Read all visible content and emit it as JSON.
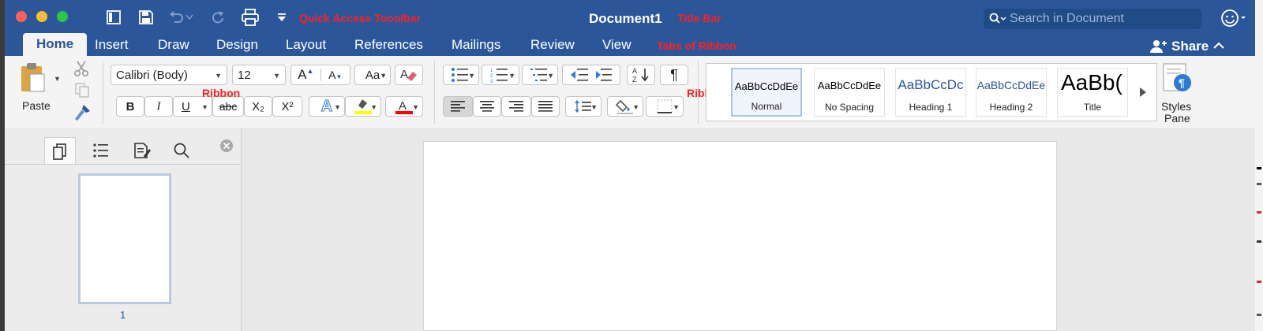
{
  "window": {
    "title": "Document1",
    "accent": "#2b579a",
    "traffic_lights": [
      "#fe5f57",
      "#febc2e",
      "#28c840"
    ]
  },
  "annotations": {
    "quick_access": "Quick Access Tooolbar",
    "title_bar": "Title Bar",
    "tabs": "Tabs of Ribbon",
    "ribbon_left": "Ribbon",
    "ribbon_right": "Ribbon",
    "color": "#ff1f1f"
  },
  "quick_access_toolbar": {
    "icons": [
      "sidebar-icon",
      "save-icon",
      "undo-icon",
      "redo-icon",
      "print-icon",
      "customize-dropdown-icon"
    ]
  },
  "search": {
    "placeholder": "Search in Document"
  },
  "tabs": [
    "Home",
    "Insert",
    "Draw",
    "Design",
    "Layout",
    "References",
    "Mailings",
    "Review",
    "View"
  ],
  "active_tab": "Home",
  "share_label": "Share",
  "ribbon": {
    "paste_label": "Paste",
    "font_name": "Calibri (Body)",
    "font_size": "12",
    "bold": "B",
    "italic": "I",
    "underline": "U",
    "strikethrough": "abc",
    "subscript": "X₂",
    "superscript": "X²",
    "highlight_color": "#ffff00",
    "font_color": "#ff0000",
    "styles": [
      {
        "preview": "AaBbCcDdEe",
        "name": "Normal"
      },
      {
        "preview": "AaBbCcDdEe",
        "name": "No Spacing"
      },
      {
        "preview": "AaBbCcDc",
        "name": "Heading 1"
      },
      {
        "preview": "AaBbCcDdEe",
        "name": "Heading 2"
      },
      {
        "preview": "AaBb(",
        "name": "Title"
      }
    ],
    "styles_pane_label_1": "Styles",
    "styles_pane_label_2": "Pane"
  },
  "nav_pane": {
    "tabs": [
      "thumbnails-icon",
      "outline-icon",
      "review-icon",
      "search-icon"
    ],
    "page_number": "1"
  }
}
